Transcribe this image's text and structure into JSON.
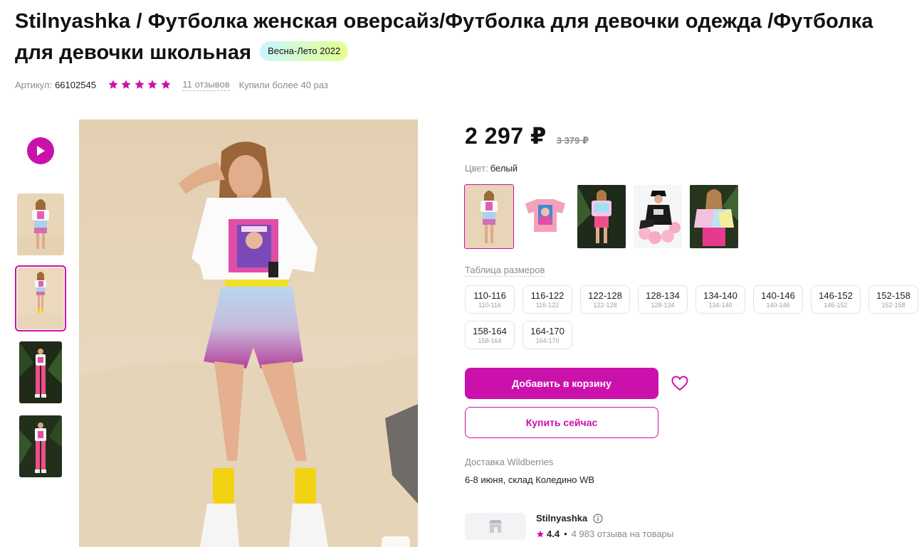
{
  "product": {
    "title": "Stilnyashka / Футболка женская оверсайз/Футболка для девочки одежда /Футболка для девочки школьная",
    "season_badge": "Весна-Лето 2022",
    "sku_label": "Артикул:",
    "sku_value": "66102545",
    "rating_stars": 5,
    "reviews_link": "11 отзывов",
    "bought_text": "Купили более 40 раз"
  },
  "gallery": {
    "play_icon": "play-icon",
    "thumbnails": [
      "photo-1",
      "photo-2",
      "photo-3",
      "photo-4"
    ],
    "active_thumbnail": 1
  },
  "pricing": {
    "price": "2 297 ₽",
    "old_price": "3 379 ₽"
  },
  "color": {
    "label": "Цвет:",
    "value": "белый",
    "variants": [
      "variant-1",
      "variant-2",
      "variant-3",
      "variant-4",
      "variant-5"
    ],
    "selected_variant": 0
  },
  "sizes": {
    "table_label": "Таблица размеров",
    "items": [
      {
        "main": "110-116",
        "sub": "110-116"
      },
      {
        "main": "116-122",
        "sub": "116-122"
      },
      {
        "main": "122-128",
        "sub": "122-128"
      },
      {
        "main": "128-134",
        "sub": "128-134"
      },
      {
        "main": "134-140",
        "sub": "134-140"
      },
      {
        "main": "140-146",
        "sub": "140-146"
      },
      {
        "main": "146-152",
        "sub": "146-152"
      },
      {
        "main": "152-158",
        "sub": "152-158"
      },
      {
        "main": "158-164",
        "sub": "158-164"
      },
      {
        "main": "164-170",
        "sub": "164-170"
      }
    ]
  },
  "actions": {
    "add_to_cart": "Добавить в корзину",
    "buy_now": "Купить сейчас",
    "favorite_icon": "heart-icon"
  },
  "delivery": {
    "label": "Доставка Wildberries",
    "info": "6-8 июня, склад Коледино WB"
  },
  "seller": {
    "name": "Stilnyashka",
    "rating": "4.4",
    "reviews": "4 983 отзыва на товары",
    "logo_icon": "store-icon"
  },
  "colors": {
    "accent": "#cb11ab",
    "star": "#cb11ab",
    "muted_text": "#8b8b8b"
  }
}
